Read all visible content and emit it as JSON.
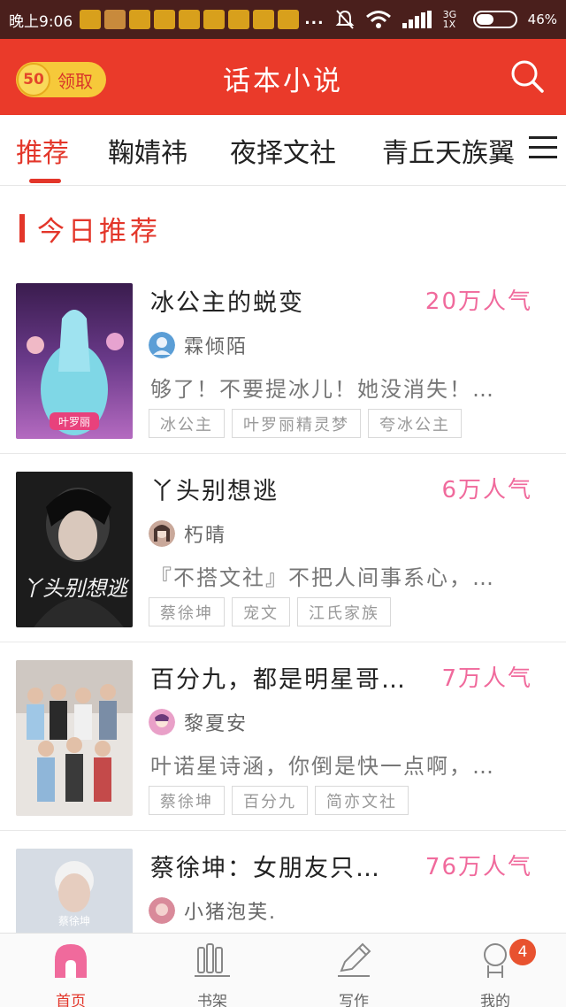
{
  "status_bar": {
    "time": "晚上9:06",
    "network": "3G 1X",
    "battery": "46%",
    "battery_fraction": 0.46,
    "overflow": "..."
  },
  "header": {
    "coin_value": "50",
    "claim_label": "领取",
    "title": "话本小说"
  },
  "tabs": [
    {
      "label": "推荐",
      "active": true
    },
    {
      "label": "鞠婧祎",
      "active": false
    },
    {
      "label": "夜择文社",
      "active": false
    },
    {
      "label": "青丘天族翼",
      "active": false
    }
  ],
  "section": {
    "title": "今日推荐"
  },
  "novels": [
    {
      "title": "冰公主的蜕变",
      "popularity": "20万人气",
      "author": "霖倾陌",
      "description": "够了！不要提冰儿！她没消失！…",
      "tags": [
        "冰公主",
        "叶罗丽精灵梦",
        "夸冰公主"
      ],
      "cover_text": "叶罗丽"
    },
    {
      "title": "丫头别想逃",
      "popularity": "6万人气",
      "author": "朽晴",
      "description": "『不搭文社』不把人间事系心，…",
      "tags": [
        "蔡徐坤",
        "宠文",
        "江氏家族"
      ],
      "cover_text": "丫头别想逃"
    },
    {
      "title": "百分九，都是明星哥…",
      "popularity": "7万人气",
      "author": "黎夏安",
      "description": "叶诺星诗涵，你倒是快一点啊，…",
      "tags": [
        "蔡徐坤",
        "百分九",
        "简亦文社"
      ],
      "cover_text": ""
    },
    {
      "title": "蔡徐坤：女朋友只…",
      "popularity": "76万人气",
      "author": "小猪泡芙.",
      "description": "",
      "tags": [],
      "cover_text": "蔡徐坤"
    }
  ],
  "bottom_nav": [
    {
      "label": "首页",
      "icon": "home-icon",
      "active": true
    },
    {
      "label": "书架",
      "icon": "bookshelf-icon",
      "active": false
    },
    {
      "label": "写作",
      "icon": "pencil-icon",
      "active": false
    },
    {
      "label": "我的",
      "icon": "profile-icon",
      "active": false,
      "badge": "4"
    }
  ],
  "colors": {
    "brand_red": "#ea3a2a",
    "accent_red": "#e3362a",
    "popularity_pink": "#f06a9c",
    "coin_yellow": "#f6c93a"
  }
}
